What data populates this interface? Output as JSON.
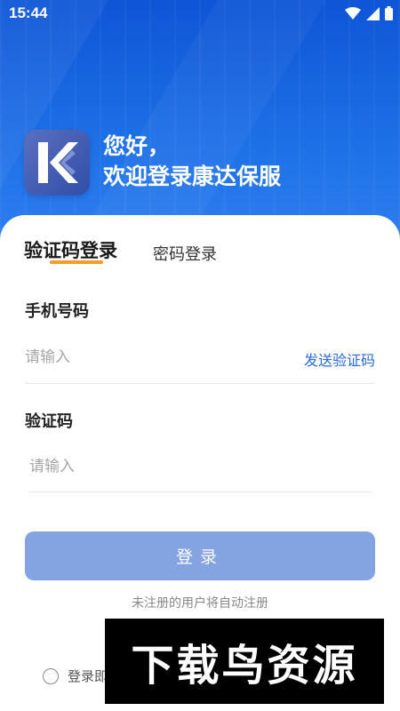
{
  "status_bar": {
    "time": "15:44",
    "icons": [
      "wifi-icon",
      "signal-icon",
      "battery-icon"
    ]
  },
  "header": {
    "logo_icon": "kangda-logo",
    "greeting_line1": "您好，",
    "greeting_line2": "欢迎登录康达保服"
  },
  "tabs": {
    "active": "验证码登录",
    "inactive": "密码登录"
  },
  "form": {
    "phone_label": "手机号码",
    "phone_placeholder": "请输入",
    "send_code_label": "发送验证码",
    "code_label": "验证码",
    "code_placeholder": "请输入"
  },
  "login_button": "登录",
  "register_note": "未注册的用户将自动注册",
  "agreement_text": "登录即",
  "watermark_text": "下载鸟资源",
  "colors": {
    "primary_blue": "#1d6fe6",
    "link_blue": "#2a6bd8",
    "accent_orange": "#f59e2a",
    "button_disabled": "#84a3e1"
  }
}
